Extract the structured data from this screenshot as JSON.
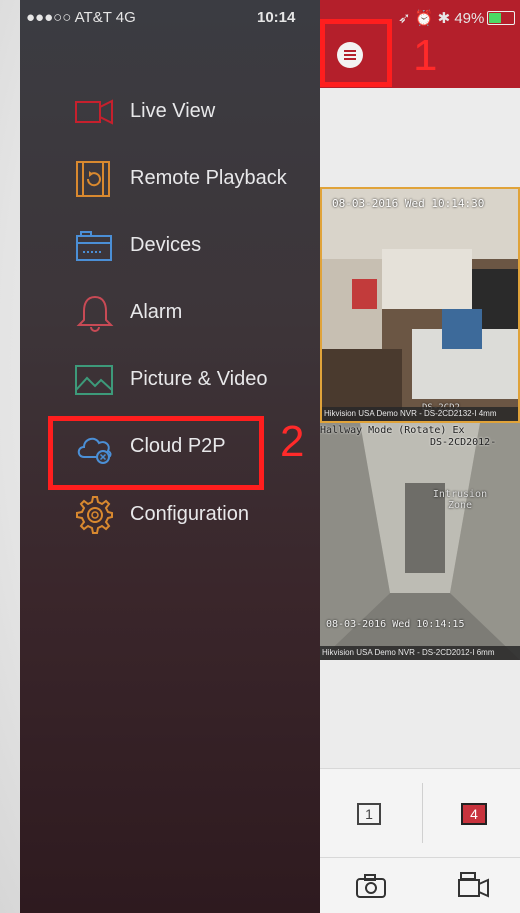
{
  "status_bar": {
    "carrier": "●●●○○ AT&T  4G",
    "time": "10:14",
    "right": "➶ ⏰ ✱ 49%",
    "battery_level": 0.49
  },
  "menu": {
    "items": [
      {
        "label": "Live View",
        "icon": "live-view-icon"
      },
      {
        "label": "Remote Playback",
        "icon": "remote-playback-icon"
      },
      {
        "label": "Devices",
        "icon": "devices-icon"
      },
      {
        "label": "Alarm",
        "icon": "alarm-icon"
      },
      {
        "label": "Picture & Video",
        "icon": "picture-video-icon"
      },
      {
        "label": "Cloud P2P",
        "icon": "cloud-p2p-icon"
      },
      {
        "label": "Configuration",
        "icon": "configuration-icon"
      }
    ]
  },
  "annotations": {
    "step1": "1",
    "step2": "2"
  },
  "cameras": [
    {
      "osd_time": "08-03-2016 Wed 10:14:30",
      "osd_name": "DS-2CD2",
      "label": "Hikvision USA Demo NVR - DS-2CD2132-I  4mm"
    },
    {
      "osd_top": "Hallway Mode (Rotate) Ex",
      "osd_model": "DS-2CD2012-",
      "osd_zone": "Intrusion\nZone",
      "osd_time": "08-03-2016 Wed 10:14:15",
      "label": "Hikvision USA Demo NVR - DS-2CD2012-I  6mm"
    }
  ],
  "layout_buttons": {
    "single": "1",
    "quad": "4"
  },
  "colors": {
    "accent": "#b41f2b",
    "highlight": "#ff1e1e"
  }
}
